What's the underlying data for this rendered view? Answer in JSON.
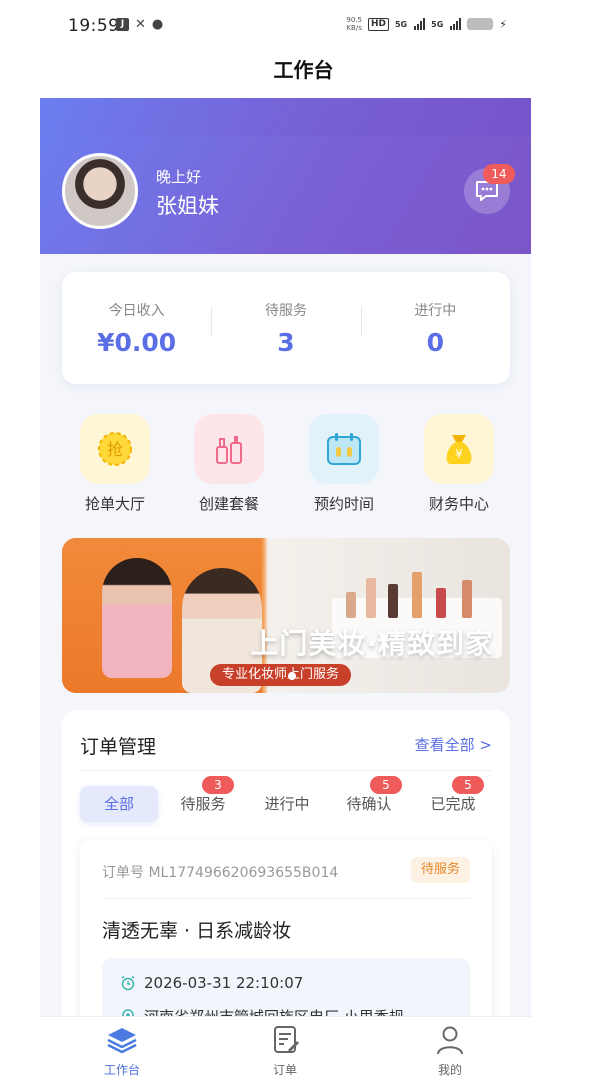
{
  "status_bar": {
    "time": "19:59",
    "net_speed_value": "90.5",
    "net_speed_unit": "KB/s",
    "hd_label": "HD",
    "sim1_label": "5G",
    "sim2_label": "5G"
  },
  "app": {
    "title": "工作台"
  },
  "profile": {
    "greeting": "晚上好",
    "name": "张姐妹",
    "message_badge": "14"
  },
  "stats": [
    {
      "label": "今日收入",
      "value": "¥0.00"
    },
    {
      "label": "待服务",
      "value": "3"
    },
    {
      "label": "进行中",
      "value": "0"
    }
  ],
  "quick_menu": [
    {
      "label": "抢单大厅",
      "icon": "grab-order-icon",
      "icon_text": "抢"
    },
    {
      "label": "创建套餐",
      "icon": "cosmetics-icon"
    },
    {
      "label": "预约时间",
      "icon": "calendar-icon"
    },
    {
      "label": "财务中心",
      "icon": "money-bag-icon",
      "icon_text": "¥"
    }
  ],
  "banner": {
    "headline": "上门美妆·精致到家",
    "subline": "专业化妆师上门服务"
  },
  "orders": {
    "title": "订单管理",
    "view_all": "查看全部 >",
    "tabs": [
      {
        "label": "全部",
        "badge": ""
      },
      {
        "label": "待服务",
        "badge": "3"
      },
      {
        "label": "进行中",
        "badge": ""
      },
      {
        "label": "待确认",
        "badge": "5"
      },
      {
        "label": "已完成",
        "badge": "5"
      }
    ],
    "current": {
      "order_no": "订单号 ML177496620693655B014",
      "status": "待服务",
      "service_name": "清透无辜 · 日系减龄妆",
      "appointment_time": "2026-03-31 22:10:07",
      "address": "河南省郑州市管城回族区电厂 小里香规"
    }
  },
  "tabbar": [
    {
      "label": "工作台",
      "icon": "layers-icon",
      "active": true
    },
    {
      "label": "订单",
      "icon": "order-doc-icon",
      "active": false
    },
    {
      "label": "我的",
      "icon": "person-icon",
      "active": false
    }
  ],
  "colors": {
    "accent": "#5a6ee6",
    "hero_start": "#6b7ff0",
    "hero_end": "#7b55c7",
    "badge": "#ef5a5a",
    "pending": "#e58a2a"
  }
}
